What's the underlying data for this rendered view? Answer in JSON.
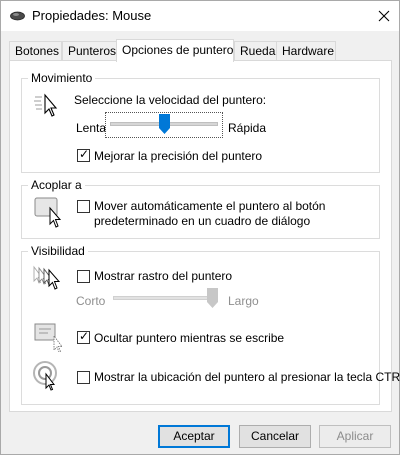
{
  "window": {
    "title": "Propiedades: Mouse",
    "close_icon": "close-icon",
    "title_icon": "mouse-icon"
  },
  "tabs": [
    {
      "label": "Botones",
      "active": false
    },
    {
      "label": "Punteros",
      "active": false
    },
    {
      "label": "Opciones de puntero",
      "active": true
    },
    {
      "label": "Rueda",
      "active": false
    },
    {
      "label": "Hardware",
      "active": false
    }
  ],
  "movimiento": {
    "title": "Movimiento",
    "speed_label": "Seleccione la velocidad del puntero:",
    "slow_label": "Lenta",
    "fast_label": "Rápida",
    "speed_level": 0.5,
    "precision_label": "Mejorar la precisión del puntero",
    "precision_checked": true
  },
  "acoplar": {
    "title": "Acoplar a",
    "snap_label_line1": "Mover automáticamente el puntero al botón",
    "snap_label_line2": "predeterminado en un cuadro de diálogo",
    "snap_checked": false
  },
  "visibilidad": {
    "title": "Visibilidad",
    "trails_label": "Mostrar rastro del puntero",
    "trails_checked": false,
    "short_label": "Corto",
    "long_label": "Largo",
    "trail_length_level": 1.0,
    "hide_label": "Ocultar puntero mientras se escribe",
    "hide_checked": true,
    "ctrl_label": "Mostrar la ubicación del puntero al presionar la tecla CTRL",
    "ctrl_checked": false
  },
  "buttons": {
    "accept": "Aceptar",
    "cancel": "Cancelar",
    "apply": "Aplicar"
  },
  "colors": {
    "accent": "#0078d7",
    "thumb": "#0078d7",
    "disabled_text": "#8c8c8c"
  }
}
